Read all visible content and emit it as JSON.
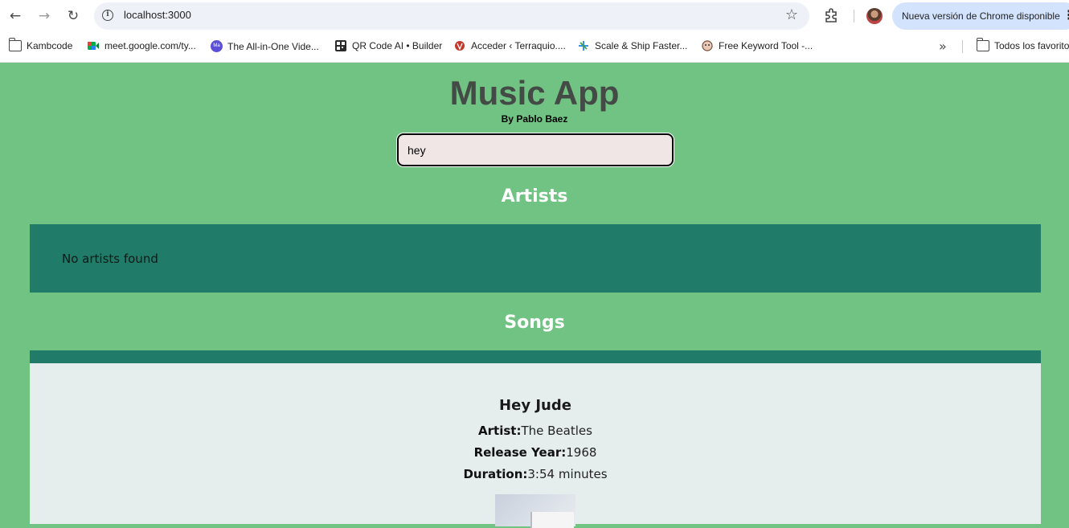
{
  "browser": {
    "url": "localhost:3000",
    "update_label": "Nueva versión de Chrome disponible",
    "bookmarks": [
      {
        "label": "Kambcode",
        "icon": "folder-icon"
      },
      {
        "label": "meet.google.com/ty...",
        "icon": "google-meet-icon"
      },
      {
        "label": "The All-in-One Vide...",
        "icon": "ma-logo-icon"
      },
      {
        "label": "QR Code AI • Builder",
        "icon": "qr-code-icon"
      },
      {
        "label": "Acceder ‹ Terraquio....",
        "icon": "wordpress-icon"
      },
      {
        "label": "Scale & Ship Faster...",
        "icon": "asterisk-icon"
      },
      {
        "label": "Free Keyword Tool -...",
        "icon": "monkey-icon"
      }
    ],
    "all_bookmarks_label": "Todos los favoritos"
  },
  "app": {
    "title": "Music App",
    "byline": "By Pablo Baez",
    "search_value": "hey",
    "artists_heading": "Artists",
    "no_artists_text": "No artists found",
    "songs_heading": "Songs",
    "song": {
      "title": "Hey Jude",
      "artist_label": "Artist:",
      "artist": "The Beatles",
      "year_label": "Release Year:",
      "year": "1968",
      "duration_label": "Duration:",
      "duration": "3:54 minutes"
    }
  },
  "colors": {
    "page_bg": "#71c383",
    "section_bg": "#207b69",
    "card_bg": "#e5eeed",
    "title_color": "#444a45"
  }
}
